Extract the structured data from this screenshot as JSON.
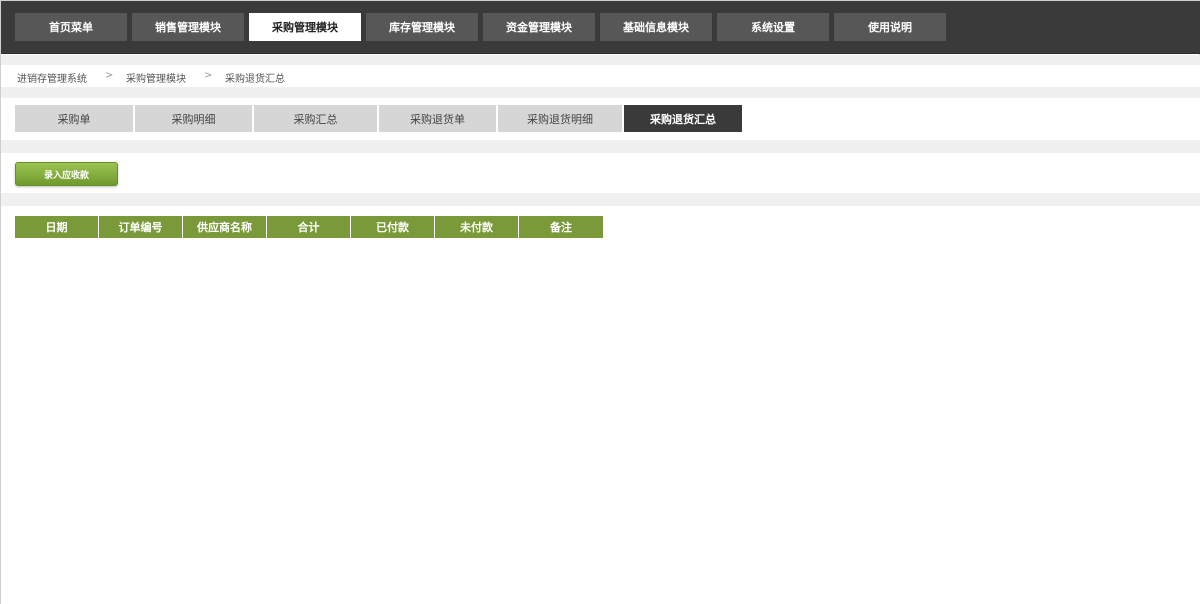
{
  "topnav": {
    "items": [
      {
        "label": "首页菜单",
        "active": false
      },
      {
        "label": "销售管理模块",
        "active": false
      },
      {
        "label": "采购管理模块",
        "active": true
      },
      {
        "label": "库存管理模块",
        "active": false
      },
      {
        "label": "资金管理模块",
        "active": false
      },
      {
        "label": "基础信息模块",
        "active": false
      },
      {
        "label": "系统设置",
        "active": false
      },
      {
        "label": "使用说明",
        "active": false
      }
    ]
  },
  "breadcrumb": {
    "items": [
      "进销存管理系统",
      "采购管理模块",
      "采购退货汇总"
    ],
    "separator": ">"
  },
  "subtabs": {
    "items": [
      {
        "label": "采购单",
        "active": false
      },
      {
        "label": "采购明细",
        "active": false
      },
      {
        "label": "采购汇总",
        "active": false
      },
      {
        "label": "采购退货单",
        "active": false
      },
      {
        "label": "采购退货明细",
        "active": false
      },
      {
        "label": "采购退货汇总",
        "active": true
      }
    ]
  },
  "actions": {
    "primary_label": "录入应收款"
  },
  "table": {
    "columns": [
      "日期",
      "订单编号",
      "供应商名称",
      "合计",
      "已付款",
      "未付款",
      "备注"
    ],
    "rows": []
  },
  "colors": {
    "nav_bg": "#3a3a3a",
    "nav_item_bg": "#575757",
    "header_green": "#7a9a3a",
    "button_green": "#8ab440"
  }
}
